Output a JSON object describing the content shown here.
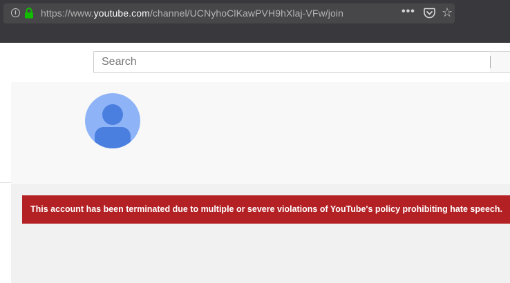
{
  "browser": {
    "url_prefix": "https://www.",
    "url_host": "youtube.com",
    "url_path": "/channel/UCNyhoClKawPVH9hXlaj-VFw/join",
    "icons": [
      "info-icon",
      "lock-icon",
      "more-actions-icon",
      "pocket-icon",
      "bookmark-star-icon"
    ]
  },
  "search": {
    "placeholder": "Search"
  },
  "channel": {
    "avatar_icon": "default-avatar-icon"
  },
  "alert": {
    "message": "This account has been terminated due to multiple or severe violations of YouTube's policy prohibiting hate speech."
  },
  "colors": {
    "alert_background": "#b32125",
    "avatar_background": "#8eb4f7",
    "avatar_figure": "#4a7fe0",
    "lock_green": "#12bc00"
  }
}
